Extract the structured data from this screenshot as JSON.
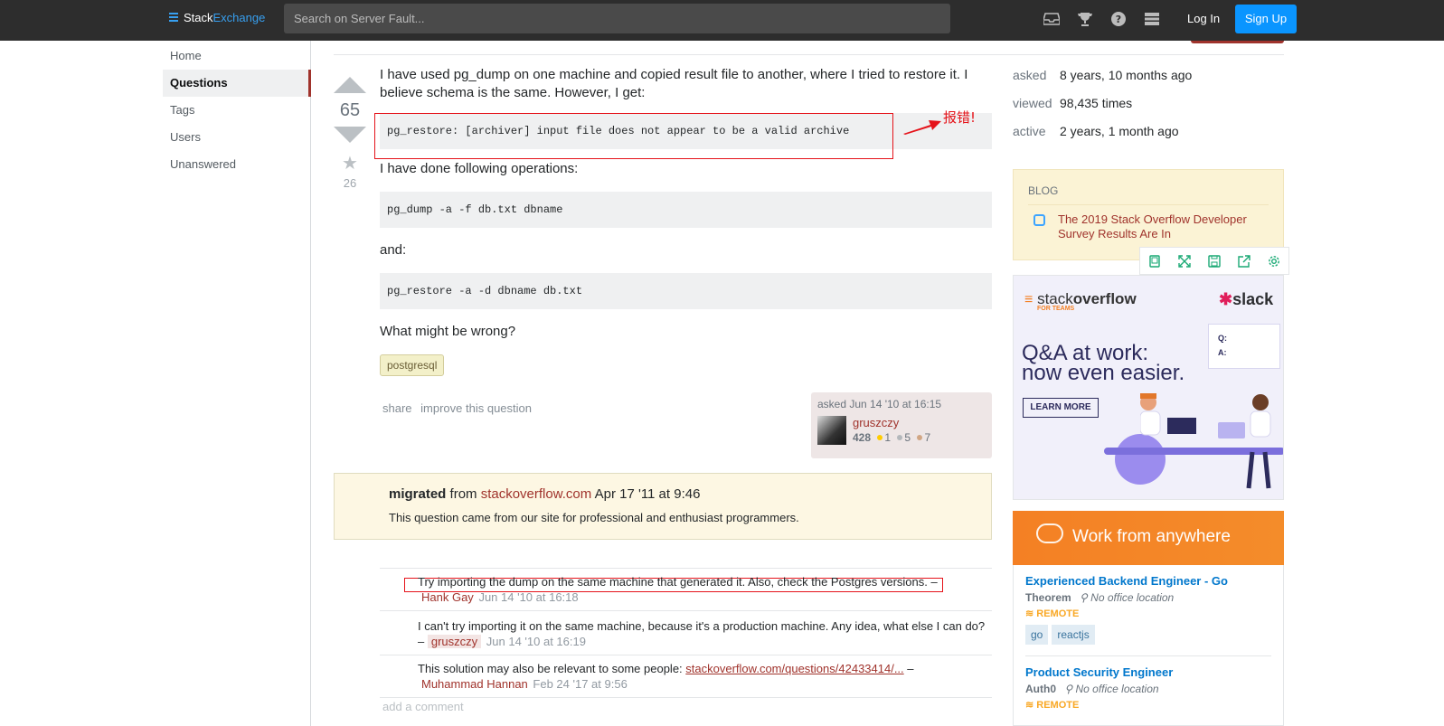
{
  "header": {
    "logo_stack": "Stack",
    "logo_exchange": "Exchange",
    "search_placeholder": "Search on Server Fault...",
    "login": "Log In",
    "signup": "Sign Up",
    "icons": [
      "inbox-icon",
      "trophy-icon",
      "help-icon",
      "site-switcher-icon"
    ]
  },
  "nav": {
    "items": [
      "Home",
      "Questions",
      "Tags",
      "Users",
      "Unanswered"
    ],
    "active": "Questions"
  },
  "question": {
    "votes": "65",
    "favorites": "26",
    "intro": "I have used pg_dump on one machine and copied result file to another, where I tried to restore it. I believe schema is the same. However, I get:",
    "error_code": "pg_restore: [archiver] input file does not appear to be a valid archive",
    "ops_text": "I have done following operations:",
    "code1": "pg_dump -a -f db.txt dbname",
    "and_text": "and:",
    "code2": "pg_restore -a -d dbname db.txt",
    "wrong_text": "What might be wrong?",
    "tag": "postgresql",
    "share": "share",
    "improve": "improve this question",
    "asked_label": "asked Jun 14 '10 at 16:15",
    "user": "gruszczy",
    "rep": "428",
    "gold": "1",
    "silver": "5",
    "bronze": "7"
  },
  "annotation": {
    "text": "报错!",
    "color": "#e5131a"
  },
  "migrated": {
    "label": "migrated",
    "from": "from",
    "site": "stackoverflow.com",
    "date": "Apr 17 '11 at 9:46",
    "note": "This question came from our site for professional and enthusiast programmers."
  },
  "comments": [
    {
      "text": "Try importing the dump on the same machine that generated it. Also, check the Postgres versions. –",
      "user": "Hank Gay",
      "date": "Jun 14 '10 at 16:18"
    },
    {
      "text": "I can't try importing it on the same machine, because it's a production machine. Any idea, what else I can do? –",
      "user": "gruszczy",
      "date": "Jun 14 '10 at 16:19"
    },
    {
      "text": "This solution may also be relevant to some people:",
      "link": "stackoverflow.com/questions/42433414/...",
      "dash": "–",
      "user": "Muhammad Hannan",
      "date": "Feb 24 '17 at 9:56"
    }
  ],
  "add_comment": "add a comment",
  "stats": {
    "asked_k": "asked",
    "asked_v": "8 years, 10 months ago",
    "viewed_k": "viewed",
    "viewed_v": "98,435 times",
    "active_k": "active",
    "active_v": "2 years, 1 month ago"
  },
  "blog": {
    "header": "BLOG",
    "item": "The 2019 Stack Overflow Developer Survey Results Are In"
  },
  "ad": {
    "so_stack": "stack",
    "so_overflow": "overflow",
    "for_teams": "FOR TEAMS",
    "slack": "slack",
    "headline1": "Q&A at work:",
    "headline2": "now even easier.",
    "learn_more": "LEARN MORE",
    "q": "Q:",
    "a": "A:"
  },
  "work": {
    "title": "Work from anywhere"
  },
  "jobs": [
    {
      "title": "Experienced Backend Engineer - Go",
      "company": "Theorem",
      "location": "No office location",
      "remote": "REMOTE",
      "tags": [
        "go",
        "reactjs"
      ]
    },
    {
      "title": "Product Security Engineer",
      "company": "Auth0",
      "location": "No office location",
      "remote": "REMOTE",
      "tags": []
    }
  ]
}
